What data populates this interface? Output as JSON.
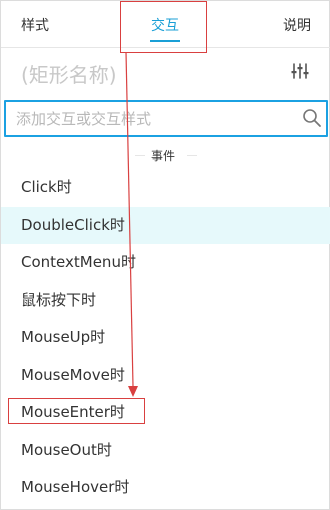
{
  "tabs": [
    {
      "label": "样式",
      "active": false
    },
    {
      "label": "交互",
      "active": true
    },
    {
      "label": "说明",
      "active": false
    }
  ],
  "widget_title": "(矩形名称)",
  "search": {
    "value": "",
    "placeholder": "添加交互或交互样式"
  },
  "section": {
    "label": "事件"
  },
  "events": [
    {
      "label": "Click时",
      "selected": false
    },
    {
      "label": "DoubleClick时",
      "selected": true
    },
    {
      "label": "ContextMenu时",
      "selected": false
    },
    {
      "label": "鼠标按下时",
      "selected": false
    },
    {
      "label": "MouseUp时",
      "selected": false
    },
    {
      "label": "MouseMove时",
      "selected": false
    },
    {
      "label": "MouseEnter时",
      "selected": false
    },
    {
      "label": "MouseOut时",
      "selected": false
    },
    {
      "label": "MouseHover时",
      "selected": false
    }
  ],
  "colors": {
    "accent": "#1a9fd6",
    "annotation": "#d94040",
    "selected_bg": "#e6f9fb"
  },
  "icons": {
    "settings": "sliders-icon",
    "search": "search-icon"
  }
}
